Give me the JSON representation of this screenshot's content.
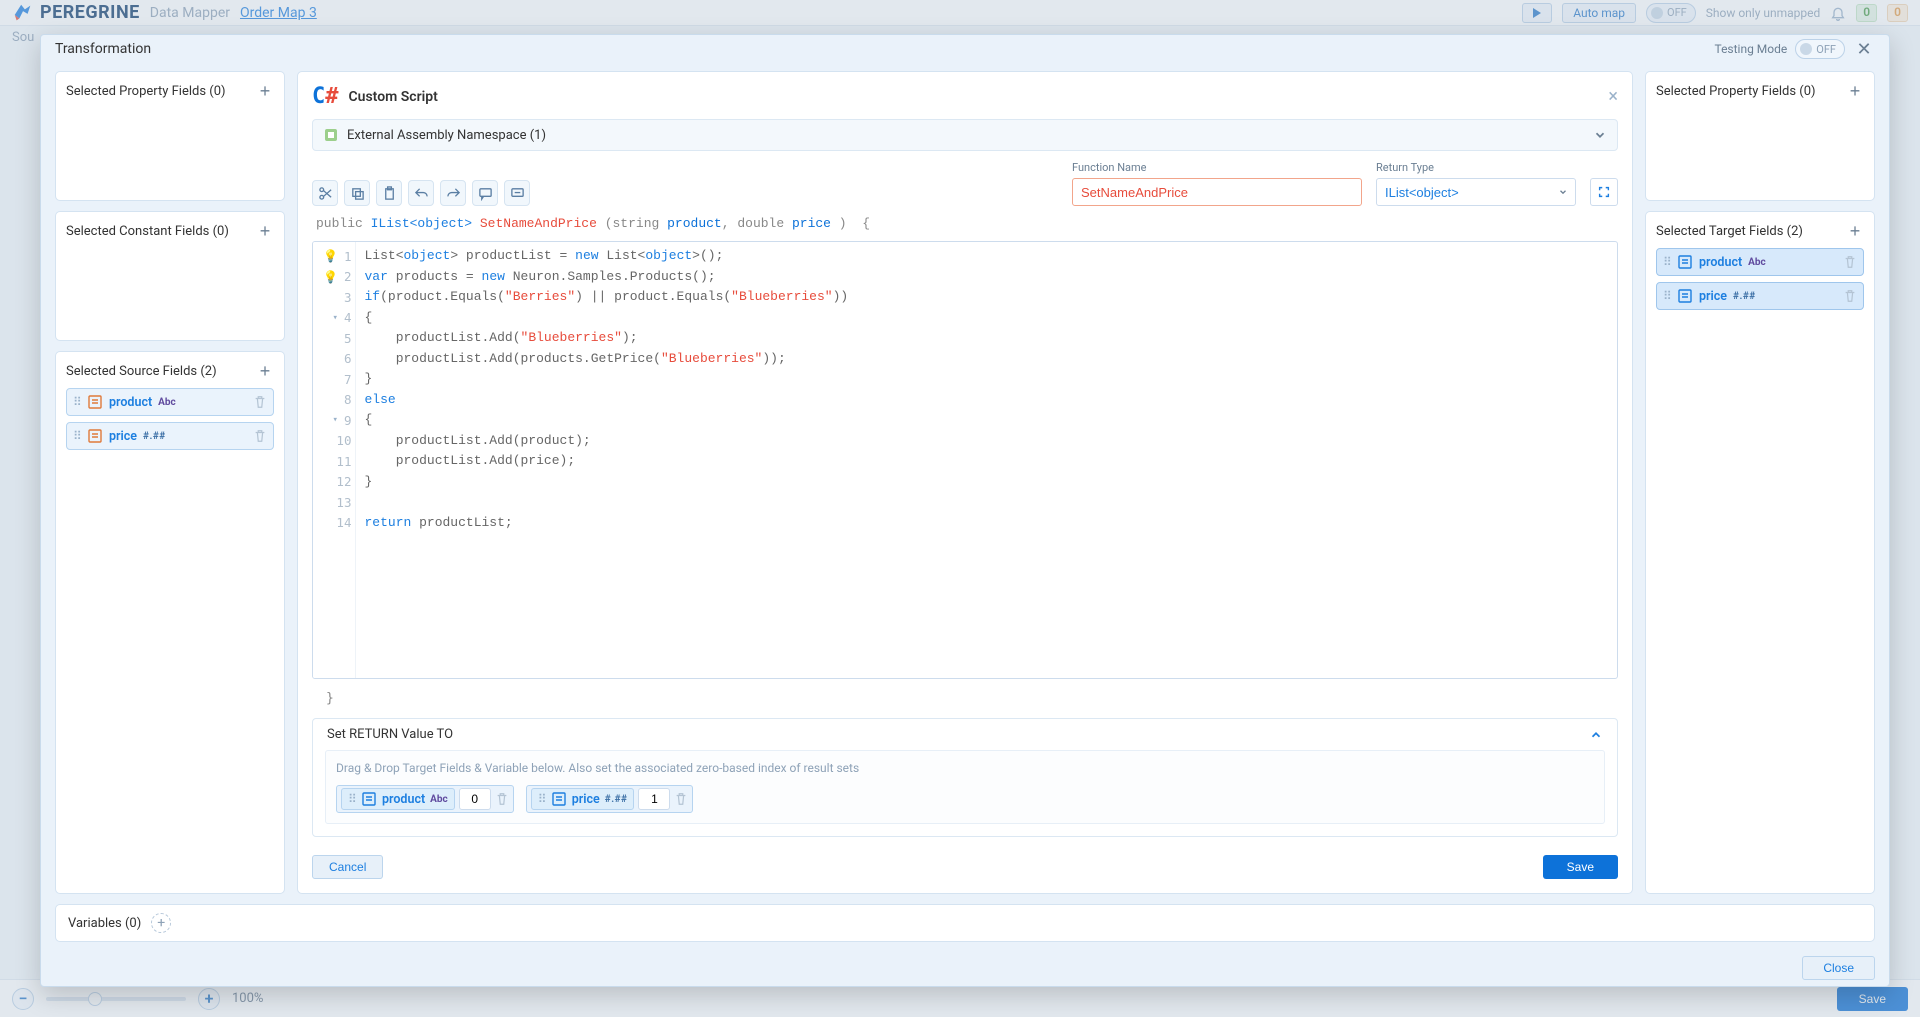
{
  "header": {
    "brand": "PEREGRINE",
    "crumb1": "Data Mapper",
    "crumb2": "Order Map 3",
    "auto_map": "Auto map",
    "off": "OFF",
    "show_unmapped": "Show only unmapped",
    "counter_green": "0",
    "counter_amber": "0"
  },
  "bg": {
    "source_label": "Sou",
    "zoom_pct": "100%",
    "save": "Save"
  },
  "modal": {
    "title": "Transformation",
    "testing_label": "Testing Mode",
    "testing_state": "OFF",
    "close": "Close"
  },
  "panels": {
    "sel_prop_left": "Selected Property Fields (0)",
    "sel_const": "Selected Constant Fields (0)",
    "sel_source": "Selected Source Fields (2)",
    "sel_prop_right": "Selected Property Fields (0)",
    "sel_target": "Selected Target Fields (2)",
    "variables": "Variables (0)"
  },
  "source_fields": [
    {
      "name": "product",
      "type": "Abc"
    },
    {
      "name": "price",
      "type": "#.##"
    }
  ],
  "target_fields": [
    {
      "name": "product",
      "type": "Abc"
    },
    {
      "name": "price",
      "type": "#.##"
    }
  ],
  "script": {
    "title": "Custom Script",
    "assembly": "External Assembly Namespace (1)",
    "fn_label": "Function Name",
    "fn_value": "SetNameAndPrice",
    "ret_label": "Return Type",
    "ret_value": "IList<object>",
    "signature": {
      "access": "public",
      "ret": "IList<object>",
      "name": "SetNameAndPrice",
      "p1_type": "string",
      "p1_name": "product",
      "p2_type": "double",
      "p2_name": "price"
    },
    "lines": [
      "List<object> productList = new List<object>();",
      "var products = new Neuron.Samples.Products();",
      "if(product.Equals(\"Berries\") || product.Equals(\"Blueberries\"))",
      "{",
      "    productList.Add(\"Blueberries\");",
      "    productList.Add(products.GetPrice(\"Blueberries\"));",
      "}",
      "else",
      "{",
      "    productList.Add(product);",
      "    productList.Add(price);",
      "}",
      "",
      "return productList;"
    ],
    "return_title": "Set RETURN Value TO",
    "return_hint": "Drag & Drop Target Fields & Variable below. Also set the associated zero-based index of result sets",
    "return_items": [
      {
        "name": "product",
        "type": "Abc",
        "index": "0"
      },
      {
        "name": "price",
        "type": "#.##",
        "index": "1"
      }
    ],
    "cancel": "Cancel",
    "save": "Save"
  }
}
